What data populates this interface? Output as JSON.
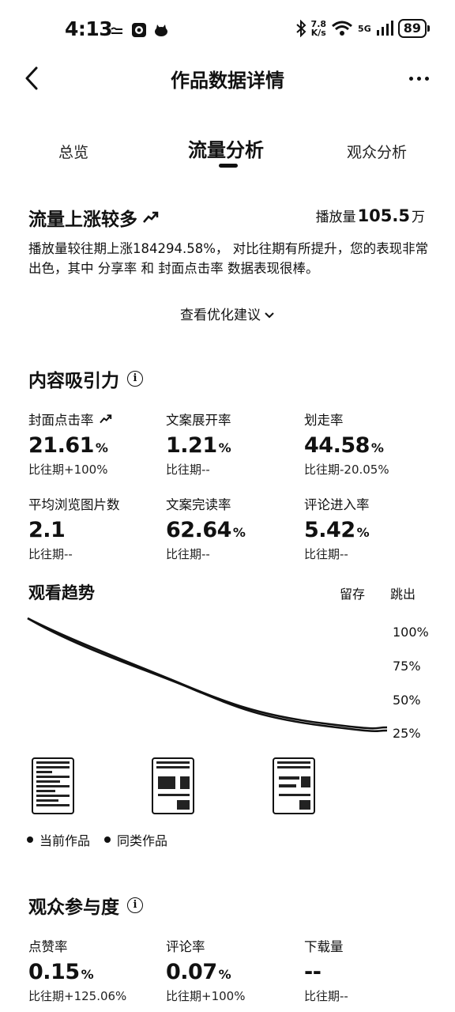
{
  "status_bar": {
    "time": "4:13",
    "speed_value": "7.8",
    "speed_unit": "K/s",
    "network": "5G",
    "battery": "89"
  },
  "header": {
    "title": "作品数据详情"
  },
  "tabs": [
    "总览",
    "流量分析",
    "观众分析"
  ],
  "flow": {
    "title": "流量上涨较多",
    "plays_label": "播放量",
    "plays_value": "105.5",
    "plays_unit": "万",
    "description": "播放量较往期上涨184294.58%， 对比往期有所提升，您的表现非常出色，其中 分享率 和 封面点击率 数据表现很棒。",
    "suggest_label": "查看优化建议"
  },
  "attraction": {
    "title": "内容吸引力",
    "metrics": [
      {
        "label": "封面点击率",
        "value": "21.61",
        "unit": "%",
        "compare": "比往期+100%"
      },
      {
        "label": "文案展开率",
        "value": "1.21",
        "unit": "%",
        "compare": "比往期--"
      },
      {
        "label": "划走率",
        "value": "44.58",
        "unit": "%",
        "compare": "比往期-20.05%"
      },
      {
        "label": "平均浏览图片数",
        "value": "2.1",
        "unit": "",
        "compare": "比往期--"
      },
      {
        "label": "文案完读率",
        "value": "62.64",
        "unit": "%",
        "compare": "比往期--"
      },
      {
        "label": "评论进入率",
        "value": "5.42",
        "unit": "%",
        "compare": "比往期--"
      }
    ]
  },
  "trend": {
    "title": "观看趋势",
    "tab_retain": "留存",
    "tab_exit": "跳出",
    "y_labels": [
      "100%",
      "75%",
      "50%",
      "25%"
    ],
    "legend_current": "当前作品",
    "legend_similar": "同类作品"
  },
  "engagement": {
    "title": "观众参与度",
    "metrics": [
      {
        "label": "点赞率",
        "value": "0.15",
        "unit": "%",
        "compare": "比往期+125.06%"
      },
      {
        "label": "评论率",
        "value": "0.07",
        "unit": "%",
        "compare": "比往期+100%"
      },
      {
        "label": "下载量",
        "value": "--",
        "unit": "",
        "compare": "比往期--"
      }
    ]
  }
}
